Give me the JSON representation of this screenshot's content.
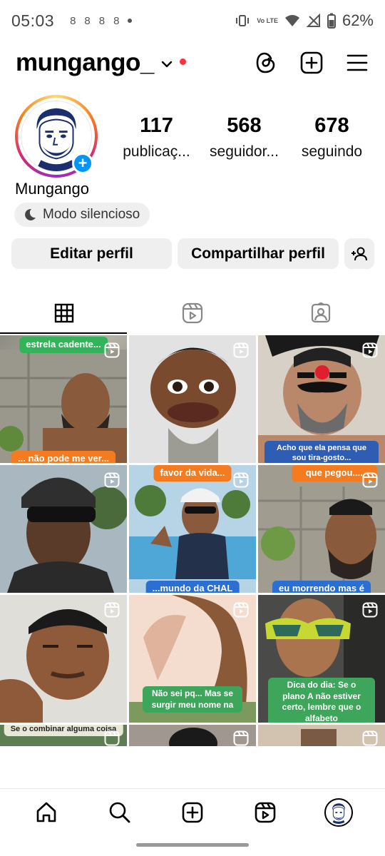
{
  "status_bar": {
    "time": "05:03",
    "notification_icons": [
      "8",
      "8",
      "8",
      "8"
    ],
    "network_label": "Vo LTE",
    "battery": "62%"
  },
  "header": {
    "username": "mungango_",
    "icons": [
      "threads-icon",
      "create-plus-icon",
      "hamburger-menu-icon"
    ],
    "accent_dot_color": "#ff3040"
  },
  "profile": {
    "display_name": "Mungango",
    "quiet_mode": "Modo silencioso",
    "stats": [
      {
        "value": "117",
        "label": "publicaç..."
      },
      {
        "value": "568",
        "label": "seguidor..."
      },
      {
        "value": "678",
        "label": "seguindo"
      }
    ]
  },
  "buttons": {
    "edit": "Editar perfil",
    "share": "Compartilhar perfil"
  },
  "tabs": [
    "grid-icon",
    "reels-icon",
    "tagged-icon"
  ],
  "grid": {
    "items": [
      {
        "caption": "estrela cadente...",
        "caption2": "... não pode me ver..."
      },
      {
        "caption": ""
      },
      {
        "caption": "Acho que ela pensa que sou tira-gosto..."
      },
      {
        "caption": ""
      },
      {
        "caption": "favor da vida...",
        "caption2": "...mundo da CHAL"
      },
      {
        "caption": "que pegou....",
        "caption2": "eu morrendo mas é"
      },
      {
        "caption": ""
      },
      {
        "caption": "Não sei pq... Mas se surgir meu nome na"
      },
      {
        "caption": "Dica do dia: Se o plano A não estiver certo, lembre que o alfabeto"
      },
      {
        "caption": "Se o combinar alguma coisa"
      },
      {
        "caption": ""
      },
      {
        "caption": ""
      }
    ]
  },
  "bottom_nav": [
    "home-icon",
    "search-icon",
    "create-icon",
    "reels-icon",
    "profile-avatar"
  ]
}
